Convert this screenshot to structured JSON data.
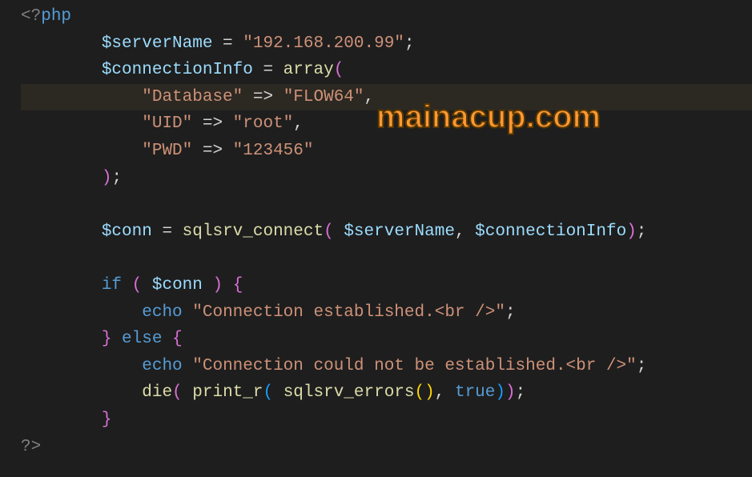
{
  "watermark": "mainacup.com",
  "gutterPartial": "",
  "lines": {
    "l1": {
      "tag_open": "<?",
      "kw": "php"
    },
    "l2": {
      "indent": "        ",
      "var": "$serverName",
      "eq": " = ",
      "str": "\"192.168.200.99\"",
      "semi": ";"
    },
    "l3": {
      "indent": "        ",
      "var": "$connectionInfo",
      "eq": " = ",
      "fn": "array",
      "p1": "("
    },
    "l4": {
      "indent": "            ",
      "str1": "\"Database\"",
      "arrow": " => ",
      "str2": "\"FLOW64\"",
      "comma": ","
    },
    "l5": {
      "indent": "            ",
      "str1": "\"UID\"",
      "arrow": " => ",
      "str2": "\"root\"",
      "comma": ","
    },
    "l6": {
      "indent": "            ",
      "str1": "\"PWD\"",
      "arrow": " => ",
      "str2": "\"123456\""
    },
    "l7": {
      "indent": "        ",
      "p1": ")",
      "semi": ";"
    },
    "l9": {
      "indent": "        ",
      "var": "$conn",
      "eq": " = ",
      "fn": "sqlsrv_connect",
      "p1": "(",
      "sp": " ",
      "var2": "$serverName",
      "comma": ", ",
      "var3": "$connectionInfo",
      "p2": ")",
      "semi": ";"
    },
    "l11": {
      "indent": "        ",
      "kw": "if",
      "sp": " ",
      "p1": "(",
      "sp2": " ",
      "var": "$conn",
      "sp3": " ",
      "p2": ")",
      "sp4": " ",
      "b1": "{"
    },
    "l12": {
      "indent": "            ",
      "kw": "echo",
      "sp": " ",
      "str": "\"Connection established.<br />\"",
      "semi": ";"
    },
    "l13": {
      "indent": "        ",
      "b1": "}",
      "sp": " ",
      "kw": "else",
      "sp2": " ",
      "b2": "{"
    },
    "l14": {
      "indent": "            ",
      "kw": "echo",
      "sp": " ",
      "str": "\"Connection could not be established.<br />\"",
      "semi": ";"
    },
    "l15": {
      "indent": "            ",
      "fn": "die",
      "p1": "(",
      "sp": " ",
      "fn2": "print_r",
      "p2": "(",
      "sp2": " ",
      "fn3": "sqlsrv_errors",
      "p3": "(",
      "p4": ")",
      "comma": ", ",
      "const": "true",
      "p5": ")",
      "p6": ")",
      "semi": ";"
    },
    "l16": {
      "indent": "        ",
      "b1": "}"
    },
    "l17": {
      "tag_close": "?>"
    }
  }
}
